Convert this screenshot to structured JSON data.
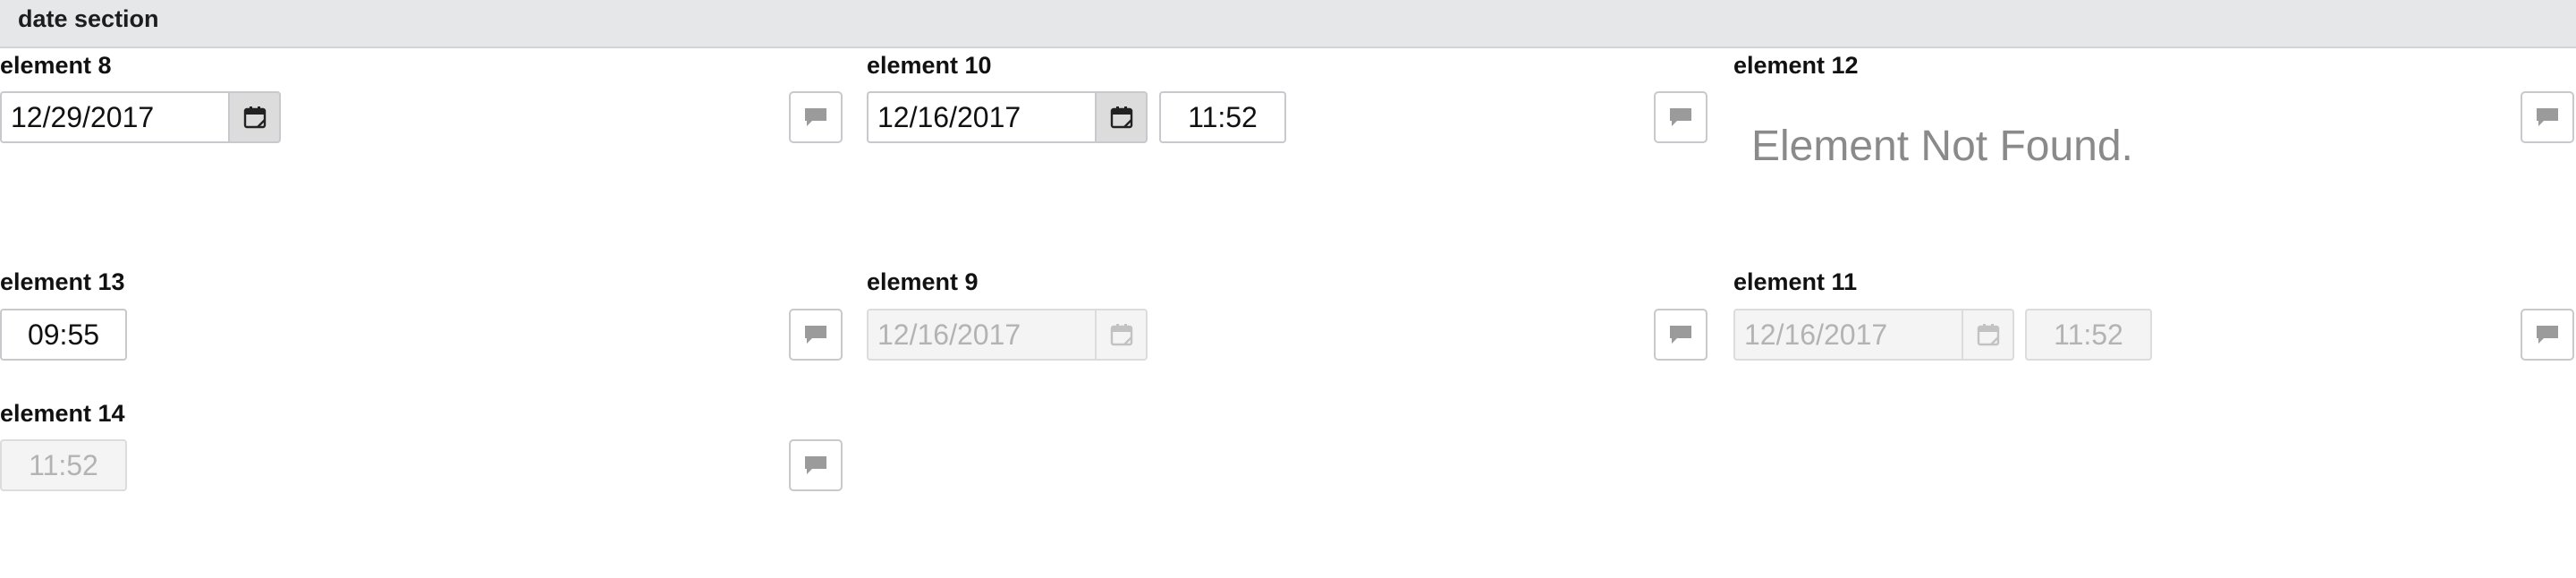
{
  "section": {
    "title": "date section"
  },
  "elements": {
    "e8": {
      "label": "element 8",
      "date": "12/29/2017"
    },
    "e10": {
      "label": "element 10",
      "date": "12/16/2017",
      "time": "11:52"
    },
    "e12": {
      "label": "element 12",
      "message": "Element Not Found."
    },
    "e13": {
      "label": "element 13",
      "time": "09:55"
    },
    "e9": {
      "label": "element 9",
      "date": "12/16/2017",
      "disabled": true
    },
    "e11": {
      "label": "element 11",
      "date": "12/16/2017",
      "time": "11:52",
      "disabled": true
    },
    "e14": {
      "label": "element 14",
      "time": "11:52",
      "disabled": true
    }
  },
  "icons": {
    "calendar": "calendar-icon",
    "comment": "comment-icon"
  },
  "colors": {
    "header_bg": "#e6e7e9",
    "disabled_text": "#b3b3b3",
    "icon": "#9b9b9b"
  }
}
